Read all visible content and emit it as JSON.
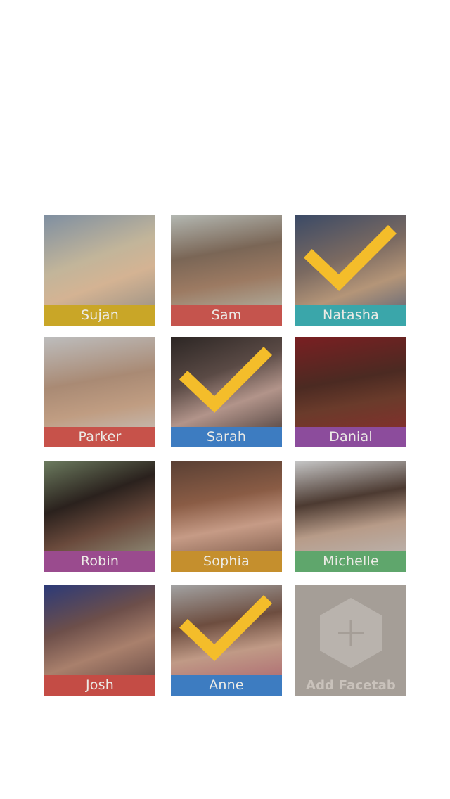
{
  "tiles": [
    {
      "name": "Sujan",
      "band_color": "#c9a627",
      "photo_bg": "linear-gradient(160deg,#7f8fa1 0%,#c2b59a 40%,#d4b393 60%,#8d8a82 100%)",
      "checked": false
    },
    {
      "name": "Sam",
      "band_color": "#c5544d",
      "photo_bg": "linear-gradient(170deg,#b3b7b1 0%,#7a6656 35%,#9c7a62 60%,#b8c1b5 100%)",
      "checked": false
    },
    {
      "name": "Natasha",
      "band_color": "#3aa6aa",
      "photo_bg": "linear-gradient(160deg,#3b4a66 0%,#7b6a61 40%,#b49578 65%,#4d5c78 100%)",
      "checked": true
    },
    {
      "name": "Parker",
      "band_color": "#c7524a",
      "photo_bg": "linear-gradient(170deg,#bdbdbd 0%,#a98a74 40%,#c09d82 65%,#c7c7c7 100%)",
      "checked": false
    },
    {
      "name": "Sarah",
      "band_color": "#3d7cc1",
      "photo_bg": "linear-gradient(160deg,#2c2624 0%,#5a4a45 35%,#b2948a 60%,#3a302e 100%)",
      "checked": true
    },
    {
      "name": "Danial",
      "band_color": "#8c4c9c",
      "photo_bg": "linear-gradient(170deg,#7a1f22 0%,#4b2a22 40%,#6a3b2b 60%,#8e2a2c 100%)",
      "checked": false
    },
    {
      "name": "Robin",
      "band_color": "#9a4b8e",
      "photo_bg": "linear-gradient(160deg,#6b7a5e 0%,#2a211d 35%,#6a4a3c 60%,#9aa08a 100%)",
      "checked": false
    },
    {
      "name": "Sophia",
      "band_color": "#c58f2d",
      "photo_bg": "linear-gradient(170deg,#5a4034 0%,#8a5c45 35%,#c69b86 60%,#6a4a3a 100%)",
      "checked": false
    },
    {
      "name": "Michelle",
      "band_color": "#5fa66c",
      "photo_bg": "linear-gradient(170deg,#c4c4c4 0%,#4c3a31 35%,#b79b88 60%,#bcbcbc 100%)",
      "checked": false
    },
    {
      "name": "Josh",
      "band_color": "#c44c45",
      "photo_bg": "linear-gradient(160deg,#2c3a78 0%,#6d4f4a 35%,#a9806c 60%,#5a3f3d 100%)",
      "checked": false
    },
    {
      "name": "Anne",
      "band_color": "#3d7cc1",
      "photo_bg": "linear-gradient(170deg,#a2a2a2 0%,#6d4d3f 35%,#c09a86 60%,#a85b6c 100%)",
      "checked": true
    }
  ],
  "add_tile": {
    "label": "Add Facetab"
  },
  "colors": {
    "check": "#f4bd2a",
    "add_hexagon": "#b9b3ad",
    "add_plus": "#a59e97"
  }
}
